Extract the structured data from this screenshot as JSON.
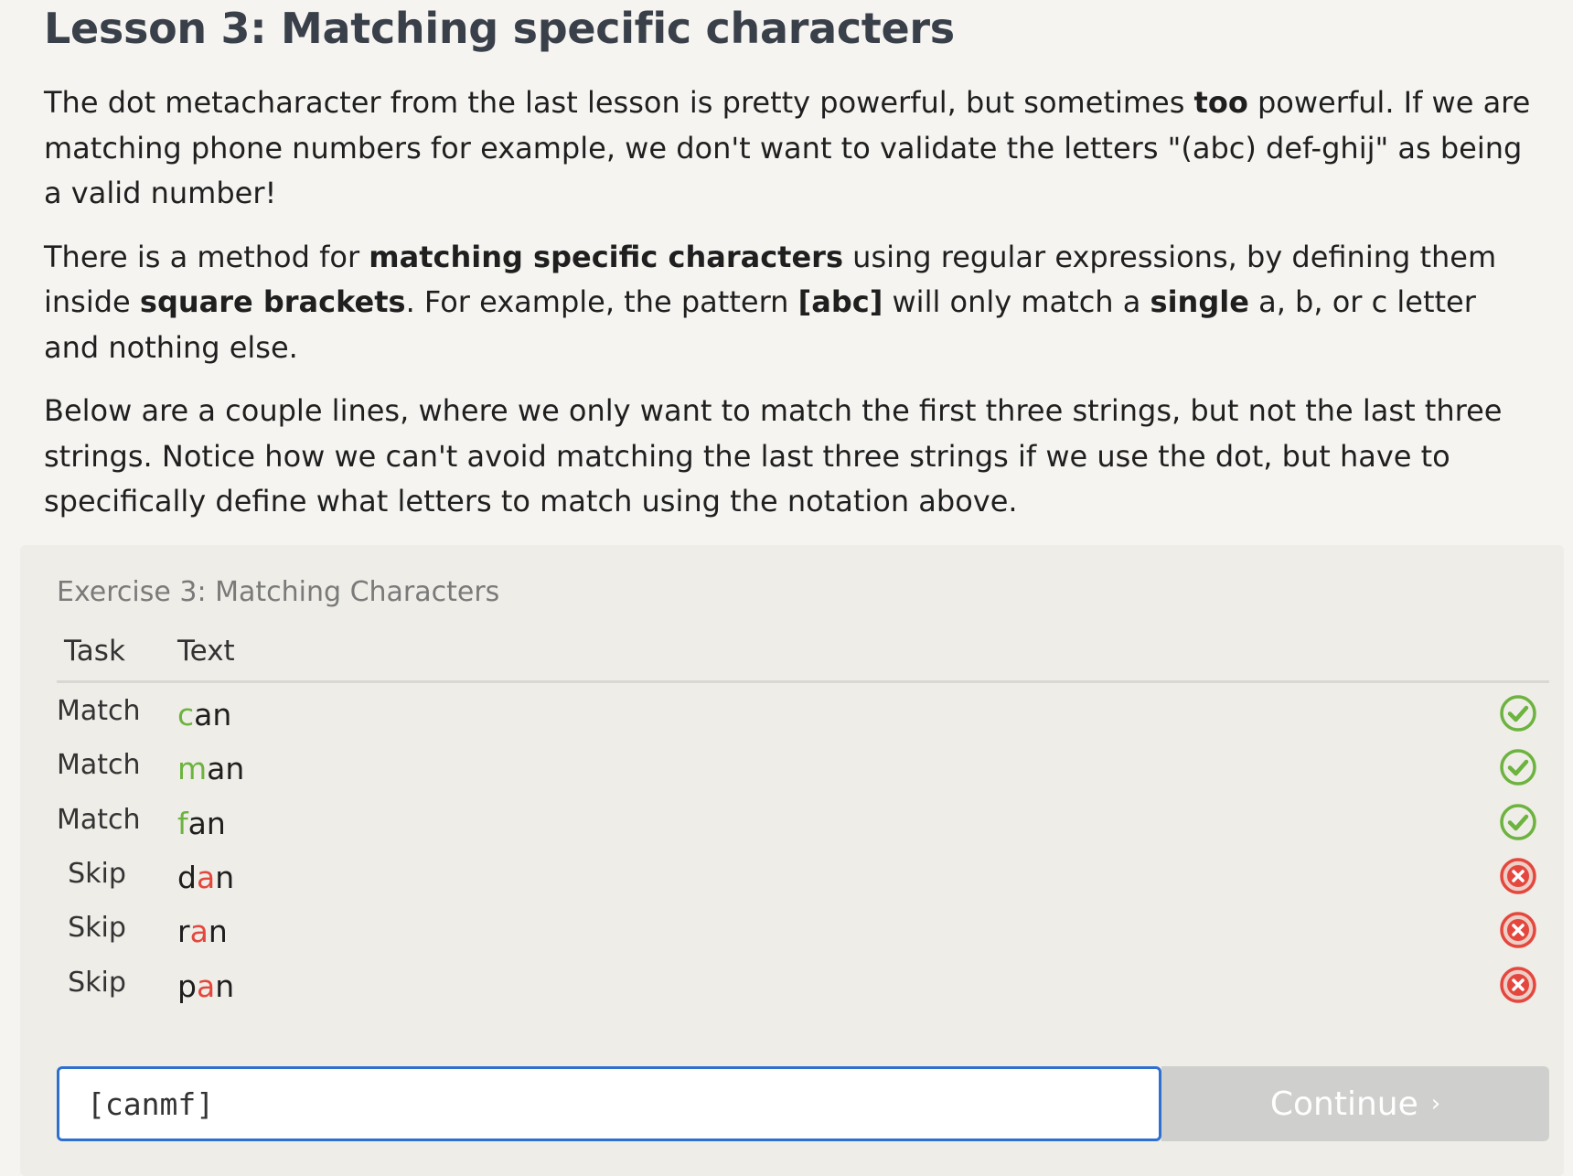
{
  "lesson": {
    "title": "Lesson 3: Matching specific characters",
    "paragraphs": [
      {
        "segments": [
          {
            "text": "The dot metacharacter from the last lesson is pretty powerful, but sometimes "
          },
          {
            "text": "too",
            "bold": true
          },
          {
            "text": " powerful. If we are matching phone numbers for example, we don't want to validate the letters \"(abc) def-ghij\" as being a valid number!"
          }
        ]
      },
      {
        "segments": [
          {
            "text": "There is a method for "
          },
          {
            "text": "matching specific characters",
            "bold": true
          },
          {
            "text": " using regular expressions, by defining them inside "
          },
          {
            "text": "square brackets",
            "bold": true
          },
          {
            "text": ". For example, the pattern "
          },
          {
            "text": "[abc]",
            "bold": true
          },
          {
            "text": " will only match a "
          },
          {
            "text": "single",
            "bold": true
          },
          {
            "text": " a, b, or c letter and nothing else."
          }
        ]
      },
      {
        "segments": [
          {
            "text": "Below are a couple lines, where we only want to match the first three strings, but not the last three strings. Notice how we can't avoid matching the last three strings if we use the dot, but have to specifically define what letters to match using the notation above."
          }
        ]
      }
    ]
  },
  "exercise": {
    "title": "Exercise 3: Matching Characters",
    "headers": {
      "task": "Task",
      "text": "Text"
    },
    "rows": [
      {
        "task": "Match",
        "parts": [
          {
            "text": "c",
            "hl": "green"
          },
          {
            "text": "an"
          }
        ],
        "status": "success"
      },
      {
        "task": "Match",
        "parts": [
          {
            "text": "m",
            "hl": "green"
          },
          {
            "text": "an"
          }
        ],
        "status": "success"
      },
      {
        "task": "Match",
        "parts": [
          {
            "text": "f",
            "hl": "green"
          },
          {
            "text": "an"
          }
        ],
        "status": "success"
      },
      {
        "task": "Skip",
        "parts": [
          {
            "text": "d"
          },
          {
            "text": "a",
            "hl": "red"
          },
          {
            "text": "n"
          }
        ],
        "status": "fail"
      },
      {
        "task": "Skip",
        "parts": [
          {
            "text": "r"
          },
          {
            "text": "a",
            "hl": "red"
          },
          {
            "text": "n"
          }
        ],
        "status": "fail"
      },
      {
        "task": "Skip",
        "parts": [
          {
            "text": "p"
          },
          {
            "text": "a",
            "hl": "red"
          },
          {
            "text": "n"
          }
        ],
        "status": "fail"
      }
    ],
    "input_value": "[canmf]",
    "continue_label": "Continue",
    "continue_chevron": "›",
    "icons": {
      "success": "check-circle-icon",
      "fail": "x-circle-icon"
    },
    "colors": {
      "success": "#6cb33f",
      "fail": "#e4473d",
      "input_border": "#2f6fd0",
      "button_disabled": "#cfcfcd"
    }
  }
}
